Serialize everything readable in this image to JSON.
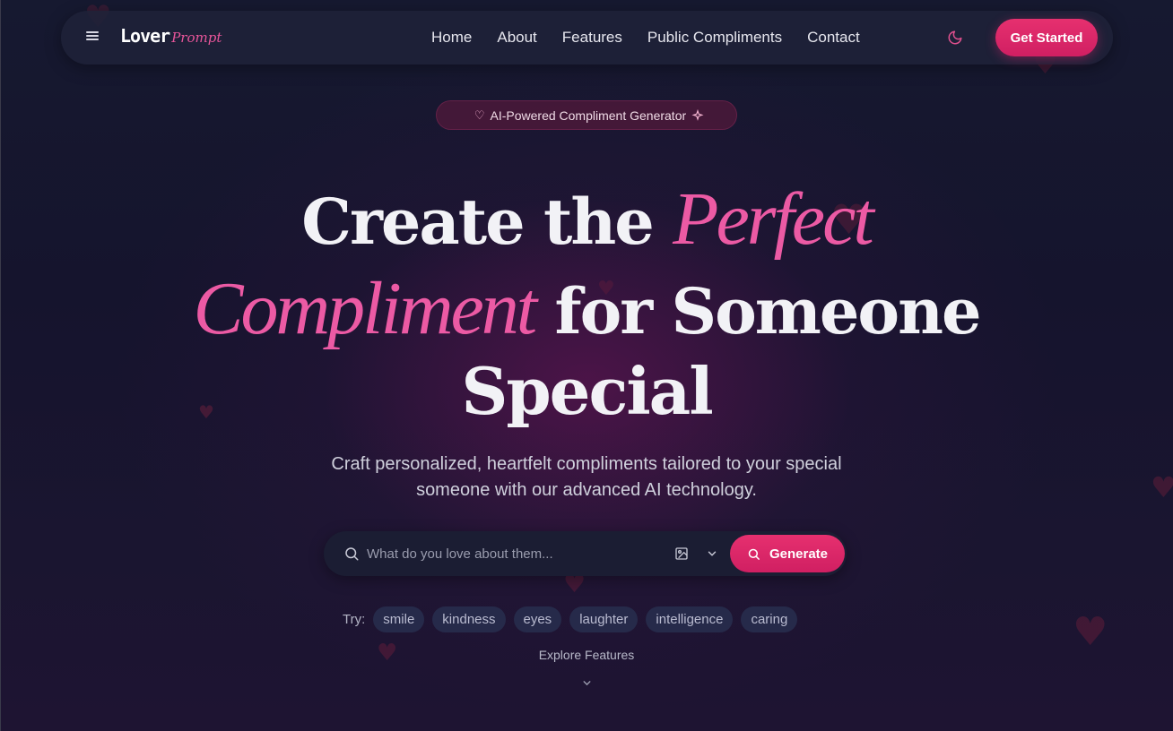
{
  "nav": {
    "logo_main": "Lover",
    "logo_script": "Prompt",
    "links": [
      "Home",
      "About",
      "Features",
      "Public Compliments",
      "Contact"
    ],
    "cta_label": "Get Started"
  },
  "hero": {
    "badge": "AI-Powered Compliment Generator",
    "headline": {
      "line1_plain": "Create the",
      "line1_script": "Perfect",
      "line2_script": "Compliment",
      "line2_plain": "for Someone",
      "line3_plain": "Special"
    },
    "subtitle_line1": "Craft personalized, heartfelt compliments tailored to your special",
    "subtitle_line2": "someone with our advanced AI technology."
  },
  "search": {
    "placeholder": "What do you love about them...",
    "value": "",
    "generate_label": "Generate"
  },
  "suggestions": {
    "label": "Try:",
    "chips": [
      "smile",
      "kindness",
      "eyes",
      "laughter",
      "intelligence",
      "caring"
    ]
  },
  "explore": {
    "label": "Explore Features"
  },
  "icons": {
    "menu": "menu-icon",
    "moon": "moon-icon",
    "heart": "heart-icon",
    "sparkle": "sparkle-icon",
    "search": "search-icon",
    "image": "image-icon",
    "chevron": "chevron-down-icon"
  },
  "colors": {
    "accent": "#e0286a",
    "script_pink": "#ec5aa4",
    "background": "#15142d",
    "nav_bg": "#1e2238",
    "chip_bg": "#262a4a"
  }
}
